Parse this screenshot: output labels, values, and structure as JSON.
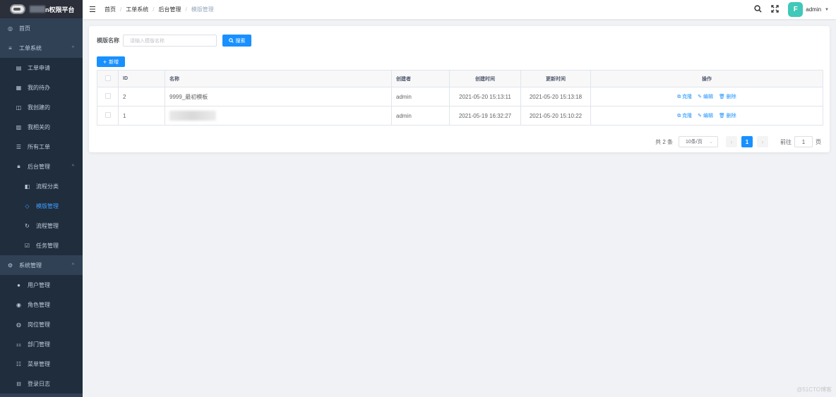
{
  "app": {
    "title": "n权限平台"
  },
  "sidebar": {
    "items": [
      {
        "label": "首页",
        "icon": "dashboard-icon",
        "level": 0
      },
      {
        "label": "工单系统",
        "icon": "ticket-icon",
        "level": 0,
        "expanded": true
      },
      {
        "label": "工单申请",
        "icon": "doc-icon",
        "level": 1
      },
      {
        "label": "我的待办",
        "icon": "todo-icon",
        "level": 1
      },
      {
        "label": "我创建的",
        "icon": "created-icon",
        "level": 1
      },
      {
        "label": "我相关的",
        "icon": "related-icon",
        "level": 1
      },
      {
        "label": "所有工单",
        "icon": "list-icon",
        "level": 1
      },
      {
        "label": "后台管理",
        "icon": "lock-icon",
        "level": 1,
        "expanded": true
      },
      {
        "label": "流程分类",
        "icon": "category-icon",
        "level": 2
      },
      {
        "label": "模版管理",
        "icon": "template-icon",
        "level": 2,
        "active": true
      },
      {
        "label": "流程管理",
        "icon": "flow-icon",
        "level": 2
      },
      {
        "label": "任务管理",
        "icon": "task-icon",
        "level": 2
      },
      {
        "label": "系统管理",
        "icon": "system-icon",
        "level": 0,
        "expanded": true
      },
      {
        "label": "用户管理",
        "icon": "user-icon",
        "level": 1
      },
      {
        "label": "角色管理",
        "icon": "role-icon",
        "level": 1
      },
      {
        "label": "岗位管理",
        "icon": "post-icon",
        "level": 1
      },
      {
        "label": "部门管理",
        "icon": "dept-icon",
        "level": 1
      },
      {
        "label": "菜单管理",
        "icon": "menu-icon",
        "level": 1
      },
      {
        "label": "登录日志",
        "icon": "log-icon",
        "level": 1
      }
    ]
  },
  "breadcrumb": [
    "首页",
    "工单系统",
    "后台管理",
    "模版管理"
  ],
  "header": {
    "user": "admin",
    "avatar_letter": "F"
  },
  "filter": {
    "label": "模版名称",
    "placeholder": "请输入模版名称",
    "search_label": "搜索"
  },
  "toolbar": {
    "add_label": "新增"
  },
  "table": {
    "columns": [
      "ID",
      "名称",
      "创建者",
      "创建时间",
      "更新时间",
      "操作"
    ],
    "rows": [
      {
        "id": "2",
        "name": "9999_最初模板",
        "creator": "admin",
        "created": "2021-05-20 15:13:11",
        "updated": "2021-05-20 15:13:18"
      },
      {
        "id": "1",
        "name": "",
        "creator": "admin",
        "created": "2021-05-19 16:32:27",
        "updated": "2021-05-20 15:10:22"
      }
    ],
    "actions": [
      "克隆",
      "编辑",
      "删除"
    ]
  },
  "pagination": {
    "total": "共 2 条",
    "page_size": "10条/页",
    "current": "1",
    "goto_prefix": "前往",
    "goto_value": "1",
    "goto_suffix": "页"
  },
  "watermark": "@51CTO博客",
  "colors": {
    "sidebar_bg": "#304156",
    "accent": "#1890ff"
  }
}
